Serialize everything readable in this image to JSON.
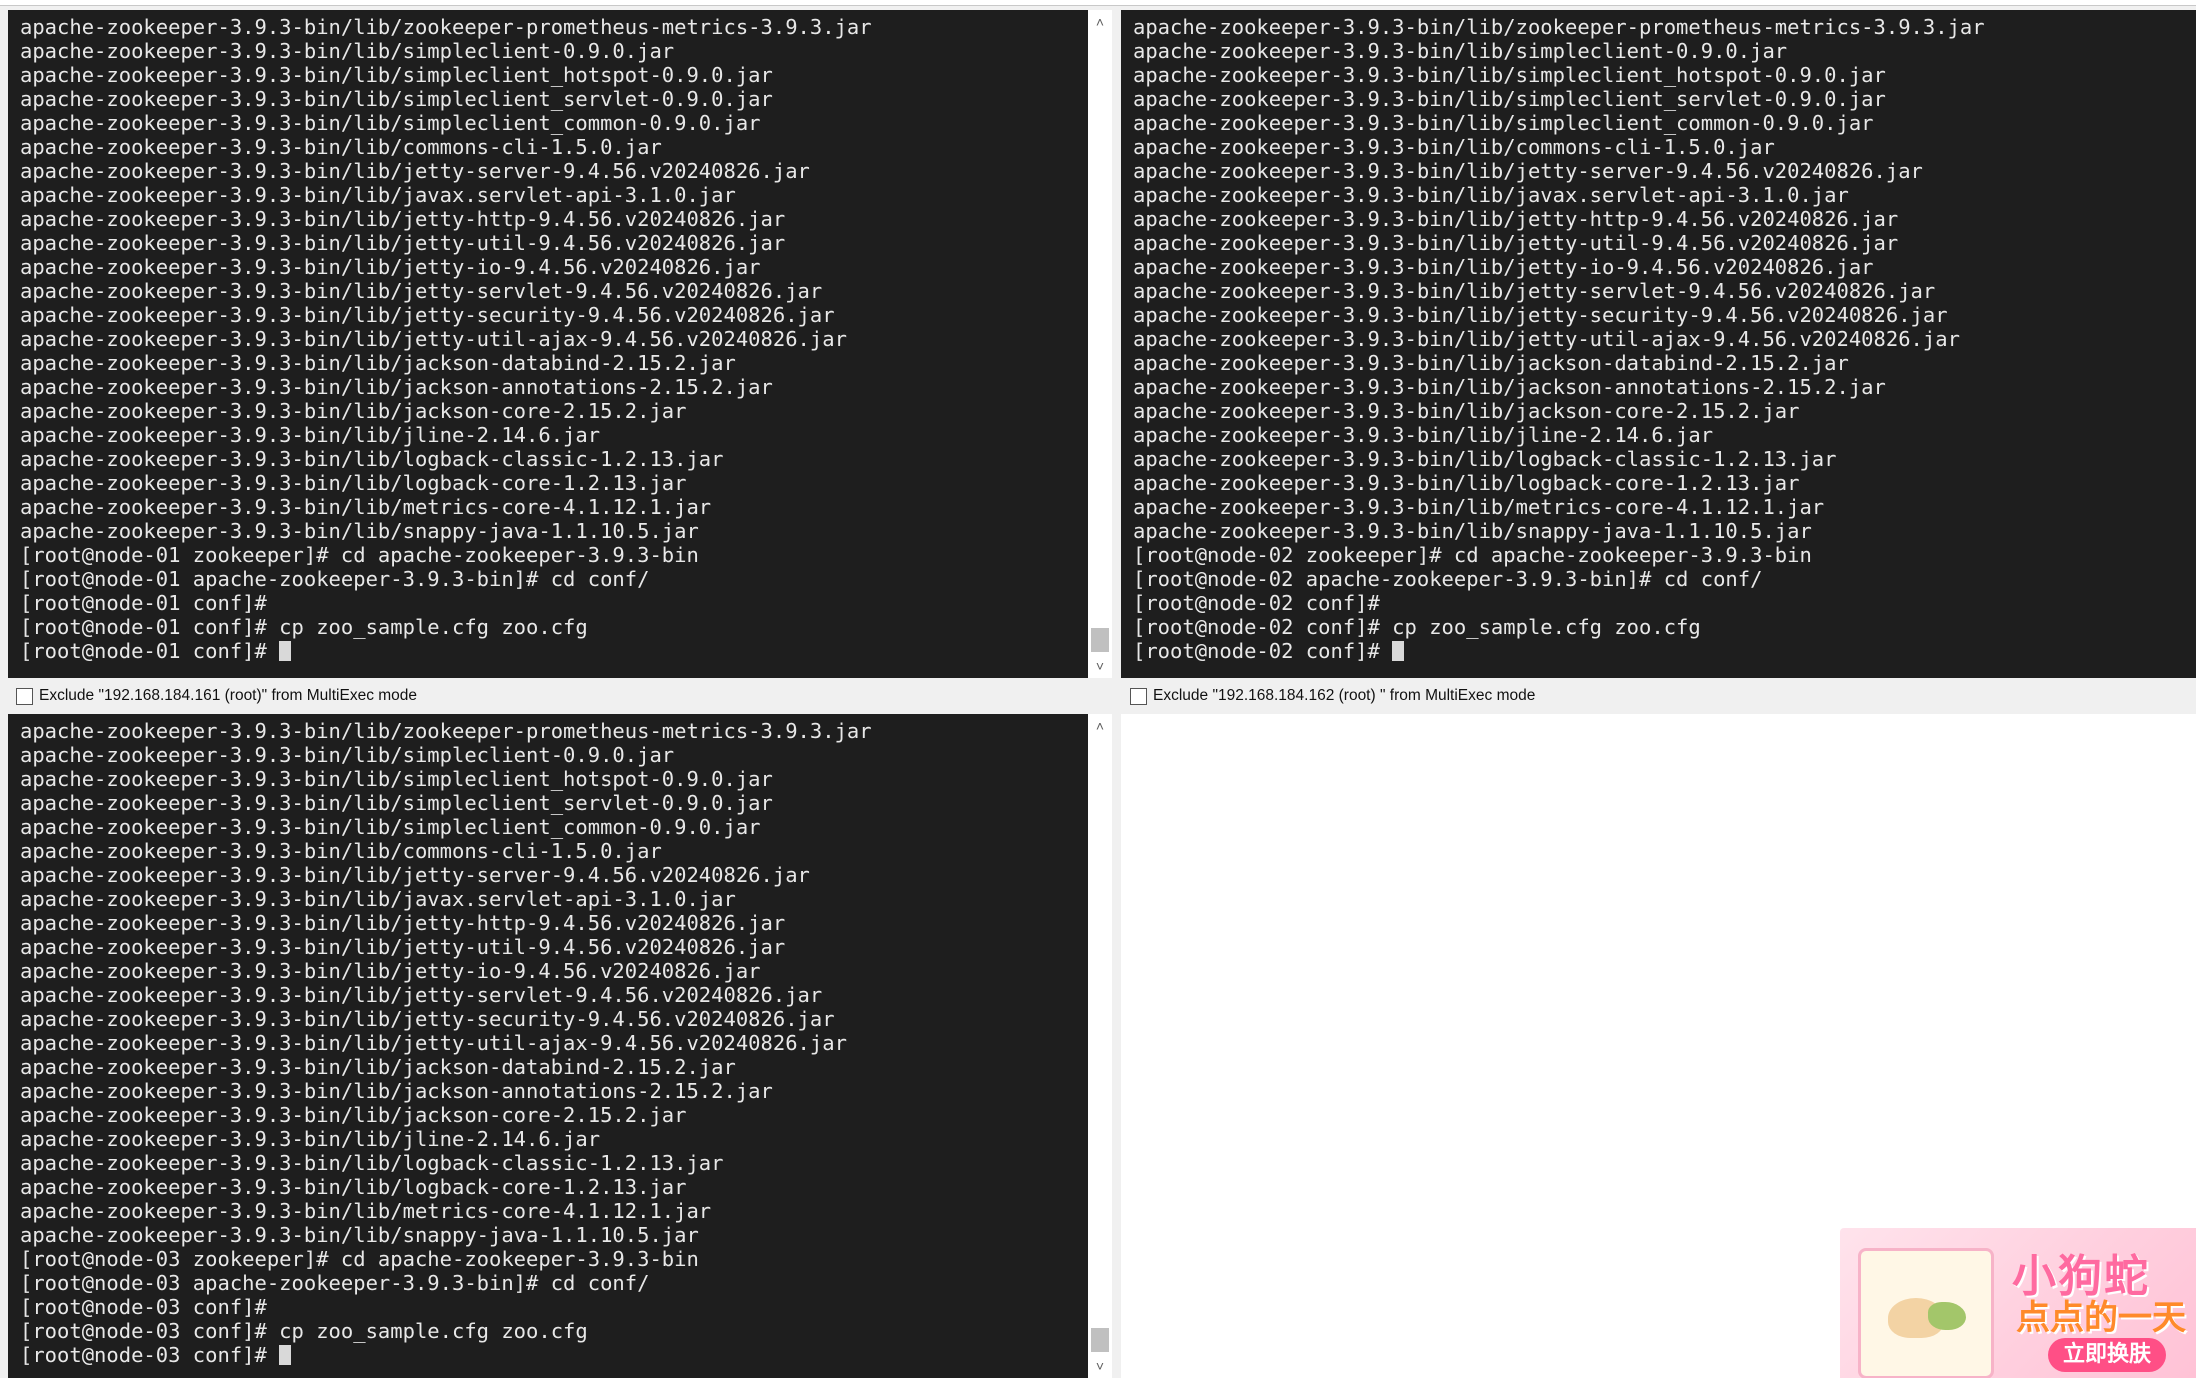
{
  "terminals": [
    {
      "lines": [
        "apache-zookeeper-3.9.3-bin/lib/zookeeper-prometheus-metrics-3.9.3.jar",
        "apache-zookeeper-3.9.3-bin/lib/simpleclient-0.9.0.jar",
        "apache-zookeeper-3.9.3-bin/lib/simpleclient_hotspot-0.9.0.jar",
        "apache-zookeeper-3.9.3-bin/lib/simpleclient_servlet-0.9.0.jar",
        "apache-zookeeper-3.9.3-bin/lib/simpleclient_common-0.9.0.jar",
        "apache-zookeeper-3.9.3-bin/lib/commons-cli-1.5.0.jar",
        "apache-zookeeper-3.9.3-bin/lib/jetty-server-9.4.56.v20240826.jar",
        "apache-zookeeper-3.9.3-bin/lib/javax.servlet-api-3.1.0.jar",
        "apache-zookeeper-3.9.3-bin/lib/jetty-http-9.4.56.v20240826.jar",
        "apache-zookeeper-3.9.3-bin/lib/jetty-util-9.4.56.v20240826.jar",
        "apache-zookeeper-3.9.3-bin/lib/jetty-io-9.4.56.v20240826.jar",
        "apache-zookeeper-3.9.3-bin/lib/jetty-servlet-9.4.56.v20240826.jar",
        "apache-zookeeper-3.9.3-bin/lib/jetty-security-9.4.56.v20240826.jar",
        "apache-zookeeper-3.9.3-bin/lib/jetty-util-ajax-9.4.56.v20240826.jar",
        "apache-zookeeper-3.9.3-bin/lib/jackson-databind-2.15.2.jar",
        "apache-zookeeper-3.9.3-bin/lib/jackson-annotations-2.15.2.jar",
        "apache-zookeeper-3.9.3-bin/lib/jackson-core-2.15.2.jar",
        "apache-zookeeper-3.9.3-bin/lib/jline-2.14.6.jar",
        "apache-zookeeper-3.9.3-bin/lib/logback-classic-1.2.13.jar",
        "apache-zookeeper-3.9.3-bin/lib/logback-core-1.2.13.jar",
        "apache-zookeeper-3.9.3-bin/lib/metrics-core-4.1.12.1.jar",
        "apache-zookeeper-3.9.3-bin/lib/snappy-java-1.1.10.5.jar",
        "[root@node-01 zookeeper]# cd apache-zookeeper-3.9.3-bin",
        "[root@node-01 apache-zookeeper-3.9.3-bin]# cd conf/",
        "[root@node-01 conf]#",
        "[root@node-01 conf]# cp zoo_sample.cfg zoo.cfg",
        "[root@node-01 conf]# "
      ],
      "exclude_label": "Exclude \"192.168.184.161 (root)\" from MultiExec mode"
    },
    {
      "lines": [
        "apache-zookeeper-3.9.3-bin/lib/zookeeper-prometheus-metrics-3.9.3.jar",
        "apache-zookeeper-3.9.3-bin/lib/simpleclient-0.9.0.jar",
        "apache-zookeeper-3.9.3-bin/lib/simpleclient_hotspot-0.9.0.jar",
        "apache-zookeeper-3.9.3-bin/lib/simpleclient_servlet-0.9.0.jar",
        "apache-zookeeper-3.9.3-bin/lib/simpleclient_common-0.9.0.jar",
        "apache-zookeeper-3.9.3-bin/lib/commons-cli-1.5.0.jar",
        "apache-zookeeper-3.9.3-bin/lib/jetty-server-9.4.56.v20240826.jar",
        "apache-zookeeper-3.9.3-bin/lib/javax.servlet-api-3.1.0.jar",
        "apache-zookeeper-3.9.3-bin/lib/jetty-http-9.4.56.v20240826.jar",
        "apache-zookeeper-3.9.3-bin/lib/jetty-util-9.4.56.v20240826.jar",
        "apache-zookeeper-3.9.3-bin/lib/jetty-io-9.4.56.v20240826.jar",
        "apache-zookeeper-3.9.3-bin/lib/jetty-servlet-9.4.56.v20240826.jar",
        "apache-zookeeper-3.9.3-bin/lib/jetty-security-9.4.56.v20240826.jar",
        "apache-zookeeper-3.9.3-bin/lib/jetty-util-ajax-9.4.56.v20240826.jar",
        "apache-zookeeper-3.9.3-bin/lib/jackson-databind-2.15.2.jar",
        "apache-zookeeper-3.9.3-bin/lib/jackson-annotations-2.15.2.jar",
        "apache-zookeeper-3.9.3-bin/lib/jackson-core-2.15.2.jar",
        "apache-zookeeper-3.9.3-bin/lib/jline-2.14.6.jar",
        "apache-zookeeper-3.9.3-bin/lib/logback-classic-1.2.13.jar",
        "apache-zookeeper-3.9.3-bin/lib/logback-core-1.2.13.jar",
        "apache-zookeeper-3.9.3-bin/lib/metrics-core-4.1.12.1.jar",
        "apache-zookeeper-3.9.3-bin/lib/snappy-java-1.1.10.5.jar",
        "[root@node-02 zookeeper]# cd apache-zookeeper-3.9.3-bin",
        "[root@node-02 apache-zookeeper-3.9.3-bin]# cd conf/",
        "[root@node-02 conf]#",
        "[root@node-02 conf]# cp zoo_sample.cfg zoo.cfg",
        "[root@node-02 conf]# "
      ],
      "exclude_label": "Exclude \"192.168.184.162 (root) \" from MultiExec mode"
    },
    {
      "lines": [
        "apache-zookeeper-3.9.3-bin/lib/zookeeper-prometheus-metrics-3.9.3.jar",
        "apache-zookeeper-3.9.3-bin/lib/simpleclient-0.9.0.jar",
        "apache-zookeeper-3.9.3-bin/lib/simpleclient_hotspot-0.9.0.jar",
        "apache-zookeeper-3.9.3-bin/lib/simpleclient_servlet-0.9.0.jar",
        "apache-zookeeper-3.9.3-bin/lib/simpleclient_common-0.9.0.jar",
        "apache-zookeeper-3.9.3-bin/lib/commons-cli-1.5.0.jar",
        "apache-zookeeper-3.9.3-bin/lib/jetty-server-9.4.56.v20240826.jar",
        "apache-zookeeper-3.9.3-bin/lib/javax.servlet-api-3.1.0.jar",
        "apache-zookeeper-3.9.3-bin/lib/jetty-http-9.4.56.v20240826.jar",
        "apache-zookeeper-3.9.3-bin/lib/jetty-util-9.4.56.v20240826.jar",
        "apache-zookeeper-3.9.3-bin/lib/jetty-io-9.4.56.v20240826.jar",
        "apache-zookeeper-3.9.3-bin/lib/jetty-servlet-9.4.56.v20240826.jar",
        "apache-zookeeper-3.9.3-bin/lib/jetty-security-9.4.56.v20240826.jar",
        "apache-zookeeper-3.9.3-bin/lib/jetty-util-ajax-9.4.56.v20240826.jar",
        "apache-zookeeper-3.9.3-bin/lib/jackson-databind-2.15.2.jar",
        "apache-zookeeper-3.9.3-bin/lib/jackson-annotations-2.15.2.jar",
        "apache-zookeeper-3.9.3-bin/lib/jackson-core-2.15.2.jar",
        "apache-zookeeper-3.9.3-bin/lib/jline-2.14.6.jar",
        "apache-zookeeper-3.9.3-bin/lib/logback-classic-1.2.13.jar",
        "apache-zookeeper-3.9.3-bin/lib/logback-core-1.2.13.jar",
        "apache-zookeeper-3.9.3-bin/lib/metrics-core-4.1.12.1.jar",
        "apache-zookeeper-3.9.3-bin/lib/snappy-java-1.1.10.5.jar",
        "[root@node-03 zookeeper]# cd apache-zookeeper-3.9.3-bin",
        "[root@node-03 apache-zookeeper-3.9.3-bin]# cd conf/",
        "[root@node-03 conf]#",
        "[root@node-03 conf]# cp zoo_sample.cfg zoo.cfg",
        "[root@node-03 conf]# "
      ]
    }
  ],
  "ad": {
    "title_line1": "小狗蛇",
    "title_line2": "点点的一天",
    "button_label": "立即换肤"
  },
  "icons": {
    "scroll_up": "chevron-up-icon",
    "scroll_down": "chevron-down-icon"
  },
  "colors": {
    "terminal_bg": "#1e1e1e",
    "terminal_fg": "#e8e8e8",
    "ad_accent": "#ff4f86"
  }
}
